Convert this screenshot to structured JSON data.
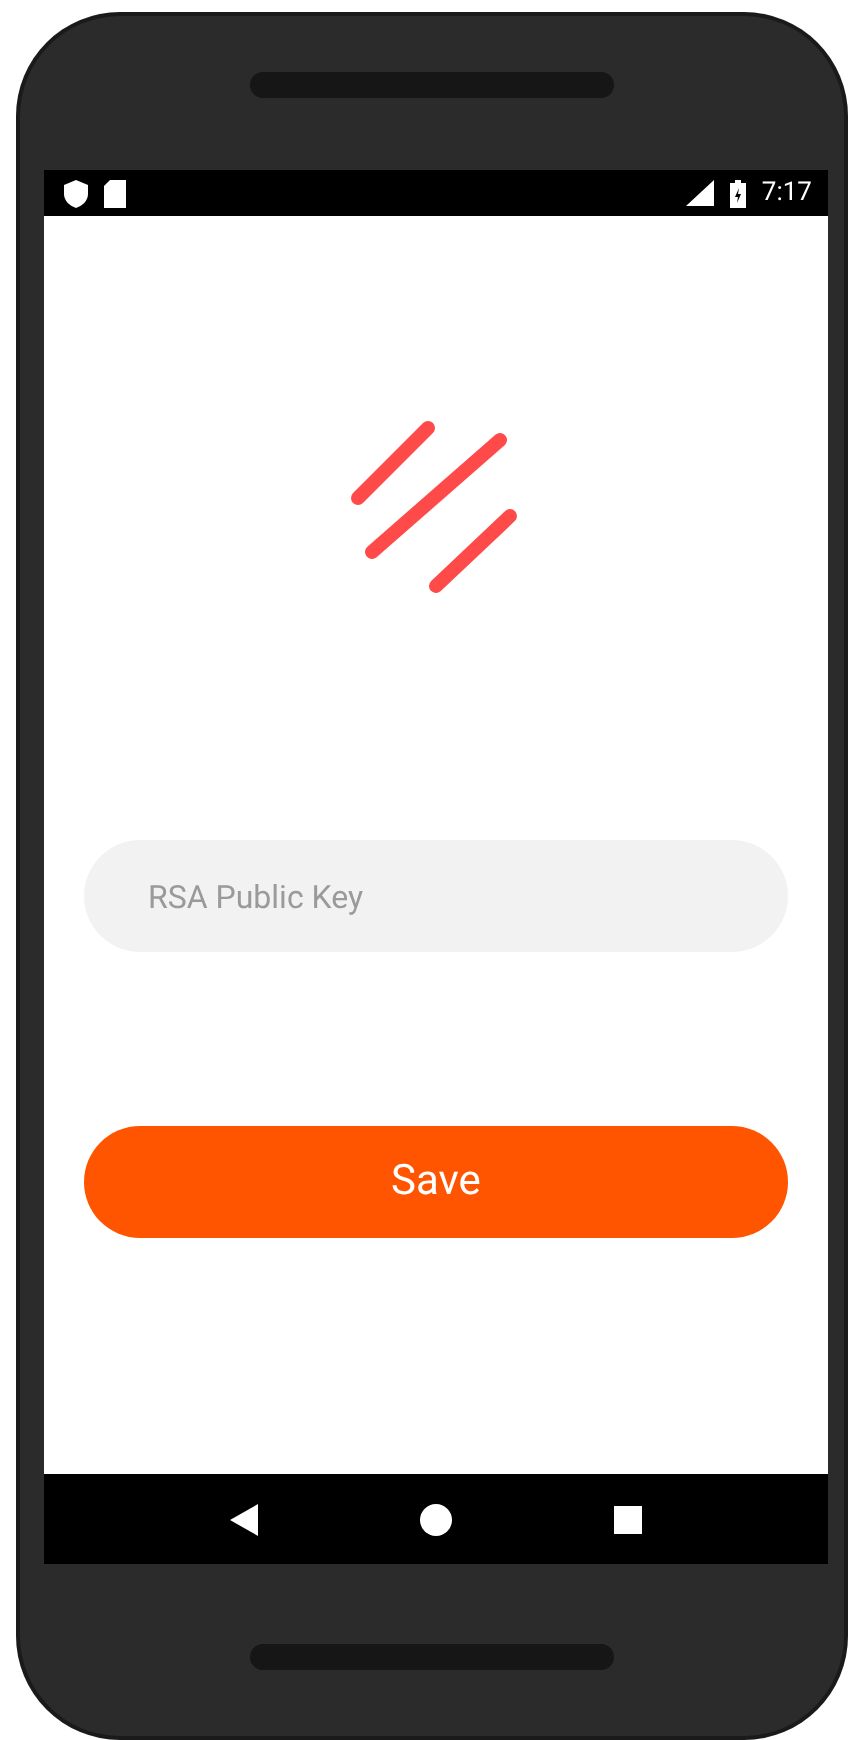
{
  "status_bar": {
    "time": "7:17"
  },
  "key_field": {
    "placeholder": "RSA Public Key"
  },
  "save_button": {
    "label": "Save"
  }
}
